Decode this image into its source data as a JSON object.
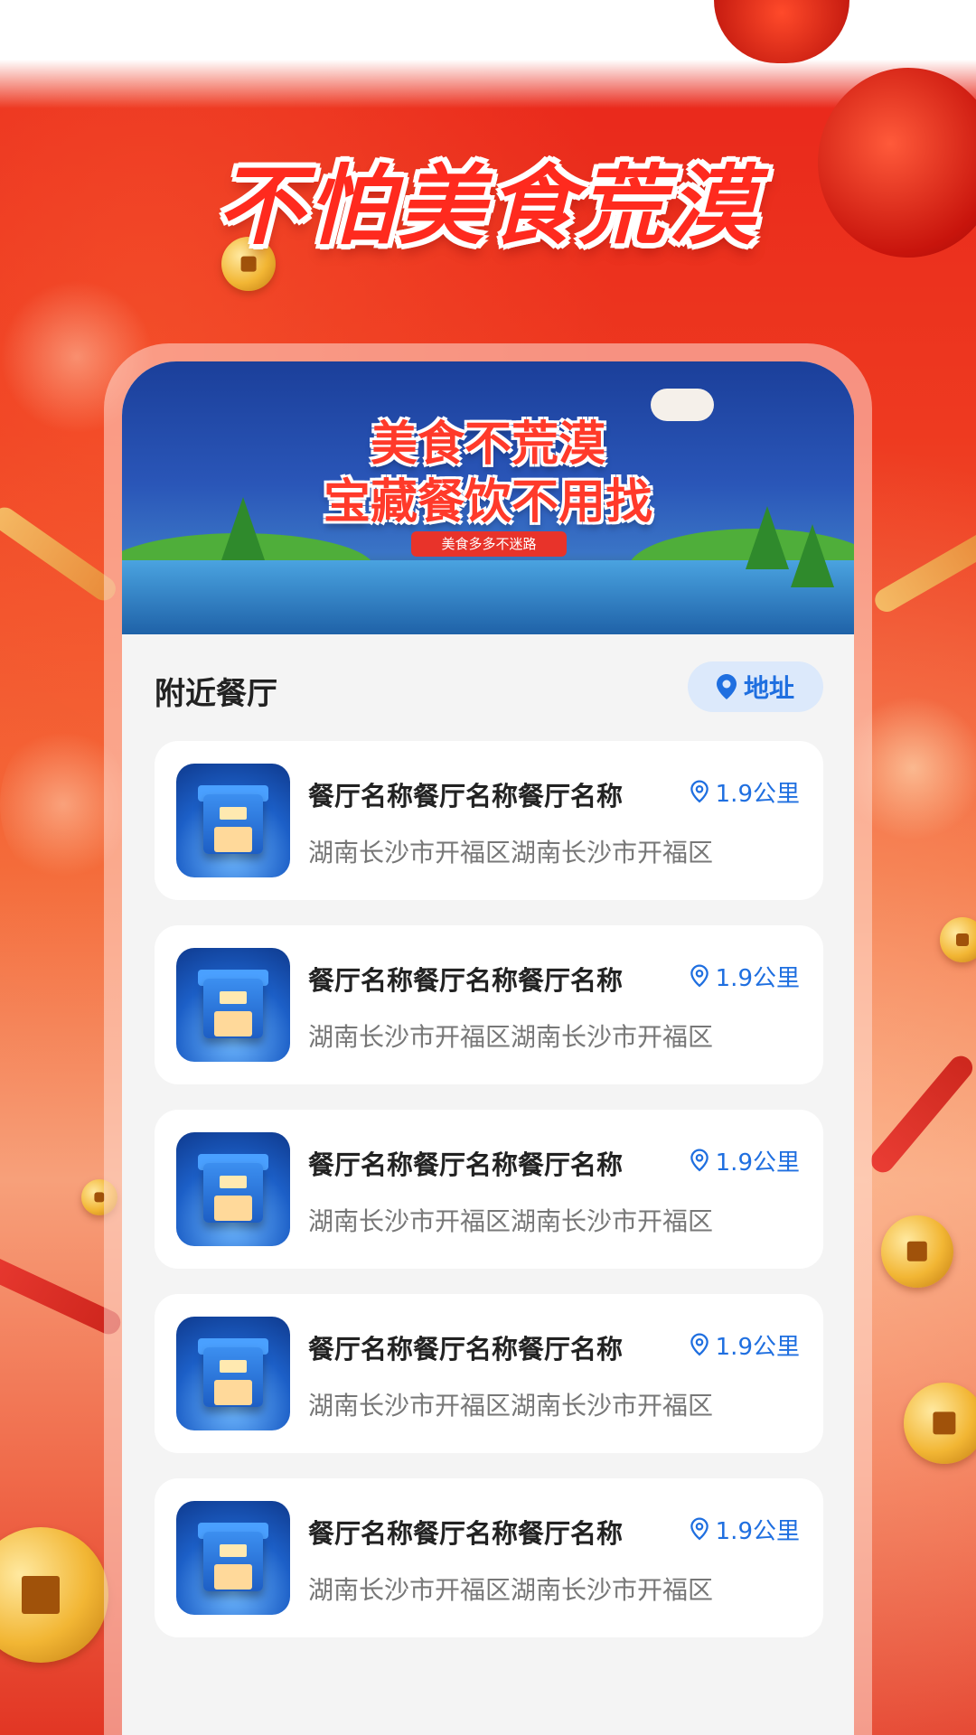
{
  "page": {
    "headline": "不怕美食荒漠"
  },
  "banner": {
    "title_line1": "美食不荒漠",
    "title_line2": "宝藏餐饮不用找",
    "tag": "美食多多不迷路"
  },
  "section": {
    "title": "附近餐厅",
    "address_button": "地址",
    "address_icon": "location-pin-icon"
  },
  "restaurants": [
    {
      "name": "餐厅名称餐厅名称餐厅名称",
      "distance": "1.9公里",
      "address": "湖南长沙市开福区湖南长沙市开福区",
      "thumb_label": "餐厅"
    },
    {
      "name": "餐厅名称餐厅名称餐厅名称",
      "distance": "1.9公里",
      "address": "湖南长沙市开福区湖南长沙市开福区",
      "thumb_label": "餐厅"
    },
    {
      "name": "餐厅名称餐厅名称餐厅名称",
      "distance": "1.9公里",
      "address": "湖南长沙市开福区湖南长沙市开福区",
      "thumb_label": "餐厅"
    },
    {
      "name": "餐厅名称餐厅名称餐厅名称",
      "distance": "1.9公里",
      "address": "湖南长沙市开福区湖南长沙市开福区",
      "thumb_label": "餐厅"
    },
    {
      "name": "餐厅名称餐厅名称餐厅名称",
      "distance": "1.9公里",
      "address": "湖南长沙市开福区湖南长沙市开福区",
      "thumb_label": "餐厅"
    }
  ],
  "colors": {
    "primary_red": "#e8241a",
    "accent_blue": "#1f6fe0",
    "card_bg": "#f4f4f4"
  }
}
